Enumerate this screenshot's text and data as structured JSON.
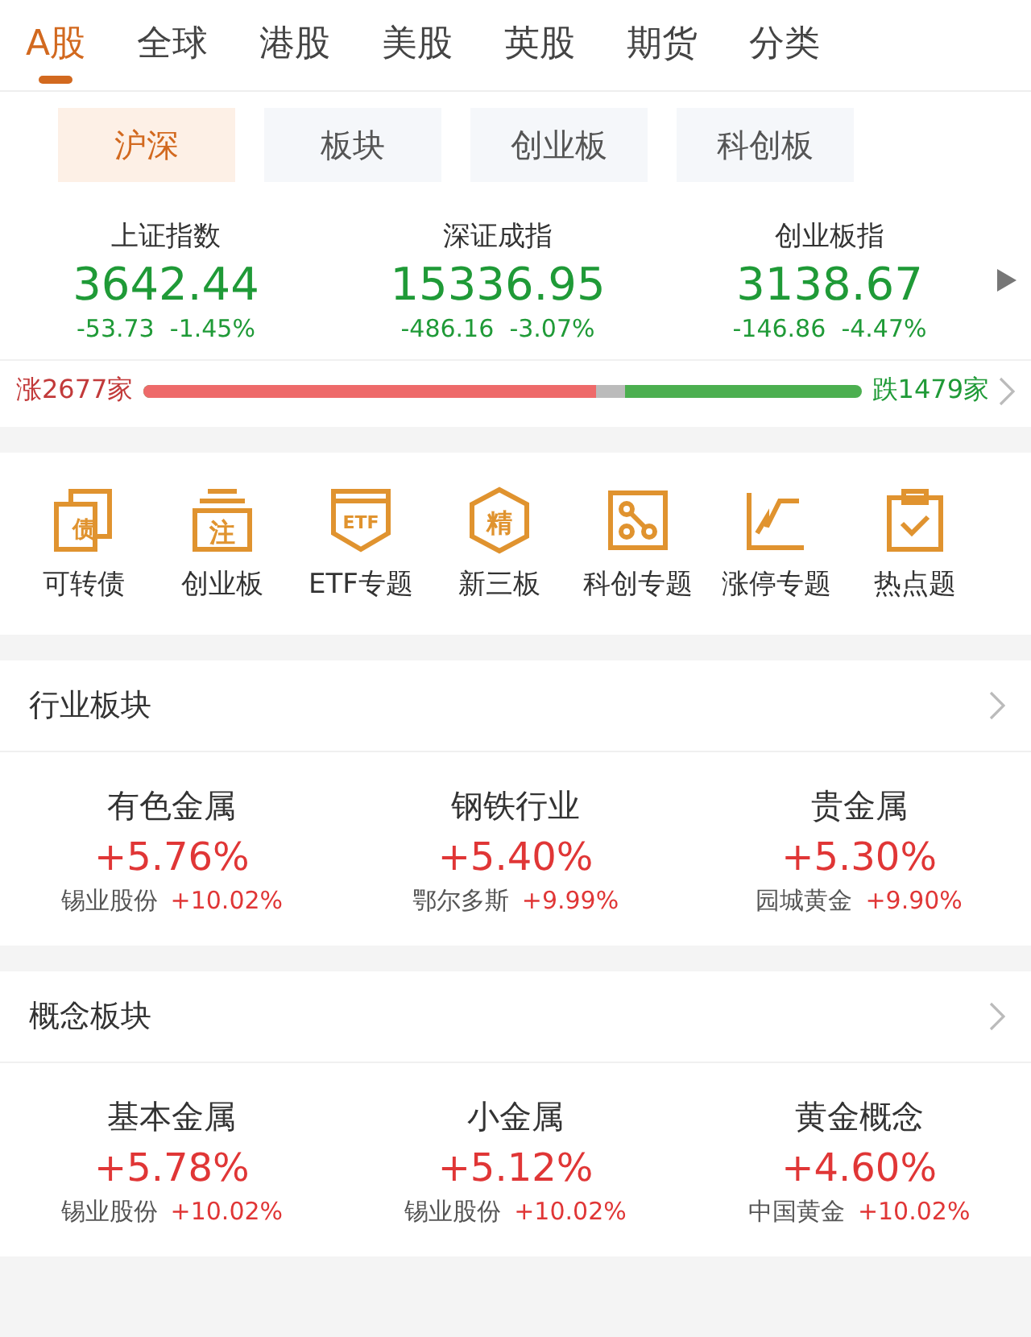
{
  "market_tabs": [
    {
      "label": "A股",
      "selected": true
    },
    {
      "label": "全球",
      "selected": false
    },
    {
      "label": "港股",
      "selected": false
    },
    {
      "label": "美股",
      "selected": false
    },
    {
      "label": "英股",
      "selected": false
    },
    {
      "label": "期货",
      "selected": false
    },
    {
      "label": "分类",
      "selected": false
    }
  ],
  "sub_tabs": [
    {
      "label": "沪深",
      "selected": true
    },
    {
      "label": "板块",
      "selected": false
    },
    {
      "label": "创业板",
      "selected": false
    },
    {
      "label": "科创板",
      "selected": false
    }
  ],
  "indices": [
    {
      "name": "上证指数",
      "value": "3642.44",
      "change": "-53.73",
      "percent": "-1.45%"
    },
    {
      "name": "深证成指",
      "value": "15336.95",
      "change": "-486.16",
      "percent": "-3.07%"
    },
    {
      "name": "创业板指",
      "value": "3138.67",
      "change": "-146.86",
      "percent": "-4.47%"
    }
  ],
  "breadth": {
    "up": "涨2677家",
    "down": "跌1479家",
    "level": 0.63
  },
  "shortcuts": [
    {
      "kind": "bond",
      "glyph": "债",
      "label": "可转债"
    },
    {
      "kind": "stack",
      "glyph": "注",
      "label": "创业板"
    },
    {
      "kind": "shield",
      "glyph": "ETF",
      "label": "ETF专题"
    },
    {
      "kind": "hexagon",
      "glyph": "精",
      "label": "新三板"
    },
    {
      "kind": "nodes",
      "label": "科创专题"
    },
    {
      "kind": "steps",
      "label": "涨停专题"
    },
    {
      "kind": "clipboard",
      "label": "热点题"
    }
  ],
  "sections": [
    {
      "title": "行业板块",
      "cards": [
        {
          "name": "有色金属",
          "percent": "+5.76%",
          "stock": "锡业股份",
          "stock_percent": "+10.02%"
        },
        {
          "name": "钢铁行业",
          "percent": "+5.40%",
          "stock": "鄂尔多斯",
          "stock_percent": "+9.99%"
        },
        {
          "name": "贵金属",
          "percent": "+5.30%",
          "stock": "园城黄金",
          "stock_percent": "+9.90%"
        }
      ]
    },
    {
      "title": "概念板块",
      "cards": [
        {
          "name": "基本金属",
          "percent": "+5.78%",
          "stock": "锡业股份",
          "stock_percent": "+10.02%"
        },
        {
          "name": "小金属",
          "percent": "+5.12%",
          "stock": "锡业股份",
          "stock_percent": "+10.02%"
        },
        {
          "name": "黄金概念",
          "percent": "+4.60%",
          "stock": "中国黄金",
          "stock_percent": "+10.02%"
        }
      ]
    }
  ]
}
